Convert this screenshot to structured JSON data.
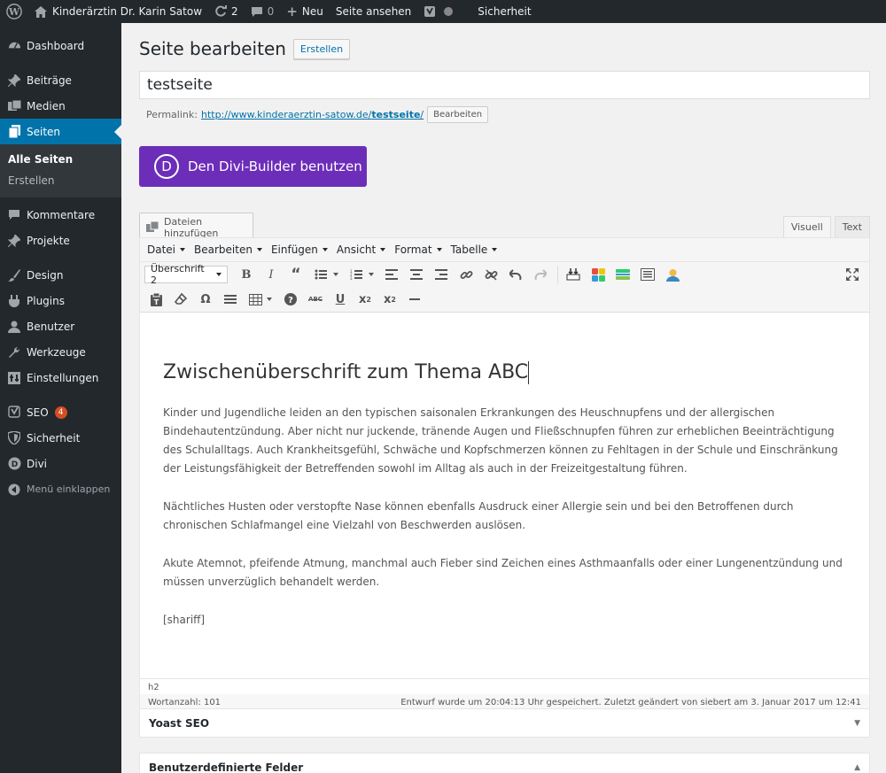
{
  "adminbar": {
    "wp_icon": "wordpress-logo-icon",
    "site_name": "Kinderärztin Dr. Karin Satow",
    "updates_count": "2",
    "comments_count": "0",
    "new_label": "Neu",
    "view_page_label": "Seite ansehen",
    "security_label": "Sicherheit"
  },
  "sidebar": {
    "items": [
      {
        "label": "Dashboard",
        "icon": "dashboard-icon"
      },
      {
        "label": "Beiträge",
        "icon": "pin-icon"
      },
      {
        "label": "Medien",
        "icon": "media-icon"
      },
      {
        "label": "Seiten",
        "icon": "pages-icon"
      },
      {
        "label": "Kommentare",
        "icon": "comment-icon"
      },
      {
        "label": "Projekte",
        "icon": "pin-icon"
      },
      {
        "label": "Design",
        "icon": "brush-icon"
      },
      {
        "label": "Plugins",
        "icon": "plugin-icon"
      },
      {
        "label": "Benutzer",
        "icon": "user-icon"
      },
      {
        "label": "Werkzeuge",
        "icon": "wrench-icon"
      },
      {
        "label": "Einstellungen",
        "icon": "settings-icon"
      },
      {
        "label": "SEO",
        "icon": "yoast-icon",
        "badge": "4"
      },
      {
        "label": "Sicherheit",
        "icon": "shield-icon"
      },
      {
        "label": "Divi",
        "icon": "divi-icon"
      },
      {
        "label": "Menü einklappen",
        "icon": "collapse-icon"
      }
    ],
    "submenu": [
      {
        "label": "Alle Seiten"
      },
      {
        "label": "Erstellen"
      }
    ]
  },
  "page": {
    "heading": "Seite bearbeiten",
    "create_button": "Erstellen",
    "title_value": "testseite",
    "permalink_label": "Permalink:",
    "permalink_url_base": "http://www.kinderaerztin-satow.de/",
    "permalink_slug": "testseite",
    "permalink_url_end": "/",
    "permalink_edit": "Bearbeiten",
    "divi_button": "Den Divi-Builder benutzen",
    "divi_logo_letter": "D",
    "add_media": "Dateien hinzufügen",
    "tab_visual": "Visuell",
    "tab_text": "Text"
  },
  "editor": {
    "menus": [
      "Datei",
      "Bearbeiten",
      "Einfügen",
      "Ansicht",
      "Format",
      "Tabelle"
    ],
    "format_select": "Überschrift 2",
    "heading": "Zwischenüberschrift zum Thema ABC",
    "paragraphs": [
      "Kinder und Jugendliche leiden an den typischen saisonalen Erkrankungen des Heuschnupfens und der allergischen Bindehautentzündung. Aber nicht nur juckende, tränende Augen und Fließschnupfen führen zur erheblichen Beeinträchtigung des Schulalltags. Auch Krankheitsgefühl, Schwäche und Kopfschmerzen können zu Fehltagen in der Schule und Einschränkung der Leistungsfähigkeit der Betreffenden sowohl im Alltag als auch in der Freizeitgestaltung führen.",
      "Nächtliches Husten oder verstopfte Nase können ebenfalls Ausdruck einer Allergie sein und bei den Betroffenen durch chronischen Schlafmangel eine Vielzahl von Beschwerden auslösen.",
      "Akute Atemnot, pfeifende Atmung, manchmal auch Fieber sind Zeichen eines Asthmaanfalls oder einer Lungenentzündung und müssen unverzüglich behandelt werden.",
      "[shariff]"
    ],
    "path": "h2",
    "word_count": "Wortanzahl: 101",
    "save_status": "Entwurf wurde um 20:04:13 Uhr gespeichert. Zuletzt geändert von siebert am 3. Januar 2017 um 12:41"
  },
  "metaboxes": {
    "yoast": "Yoast SEO",
    "custom_fields": "Benutzerdefinierte Felder"
  },
  "colors": {
    "adminbar_bg": "#23282d",
    "sidebar_active": "#0073aa",
    "divi_purple": "#6c2eb9",
    "seo_badge": "#d54e21"
  }
}
